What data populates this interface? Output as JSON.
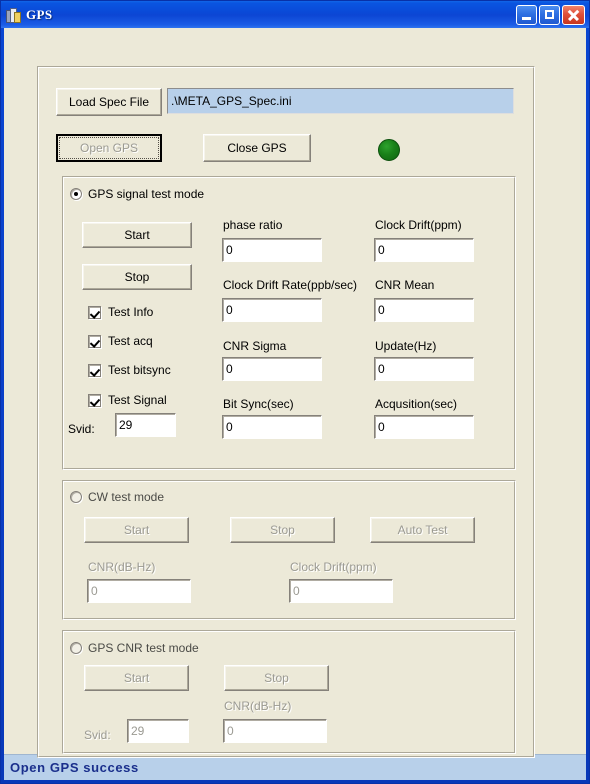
{
  "window": {
    "title": "GPS",
    "icon": "application-icon",
    "controls": {
      "minimize": "minimize-button",
      "maximize": "maximize-button",
      "close": "close-button"
    }
  },
  "toolbar": {
    "load_spec_label": "Load Spec File",
    "spec_path": ".\\META_GPS_Spec.ini",
    "open_gps_label": "Open GPS",
    "close_gps_label": "Close GPS",
    "led_color": "#198019",
    "led_name": "connection-status-led"
  },
  "gps_signal": {
    "radio_label": "GPS signal test mode",
    "selected": true,
    "start_label": "Start",
    "stop_label": "Stop",
    "checkboxes": [
      {
        "label": "Test Info",
        "checked": true
      },
      {
        "label": "Test acq",
        "checked": true
      },
      {
        "label": "Test bitsync",
        "checked": true
      },
      {
        "label": "Test Signal",
        "checked": true
      }
    ],
    "svid_label": "Svid:",
    "svid_value": "29",
    "fields": [
      {
        "label": "phase ratio",
        "value": "0"
      },
      {
        "label": "Clock Drift(ppm)",
        "value": "0"
      },
      {
        "label": "Clock Drift Rate(ppb/sec)",
        "value": "0"
      },
      {
        "label": "CNR Mean",
        "value": "0"
      },
      {
        "label": "CNR Sigma",
        "value": "0"
      },
      {
        "label": "Update(Hz)",
        "value": "0"
      },
      {
        "label": "Bit Sync(sec)",
        "value": "0"
      },
      {
        "label": "Acqusition(sec)",
        "value": "0"
      }
    ]
  },
  "cw_test": {
    "radio_label": "CW test mode",
    "selected": false,
    "start_label": "Start",
    "stop_label": "Stop",
    "auto_test_label": "Auto Test",
    "cnr_label": "CNR(dB-Hz)",
    "cnr_value": "0",
    "clock_drift_label": "Clock Drift(ppm)",
    "clock_drift_value": "0"
  },
  "gps_cnr_test": {
    "radio_label": "GPS CNR test mode",
    "selected": false,
    "start_label": "Start",
    "stop_label": "Stop",
    "svid_label": "Svid:",
    "svid_value": "29",
    "cnr_label": "CNR(dB-Hz)",
    "cnr_value": "0"
  },
  "statusbar": {
    "message": "Open GPS success"
  }
}
